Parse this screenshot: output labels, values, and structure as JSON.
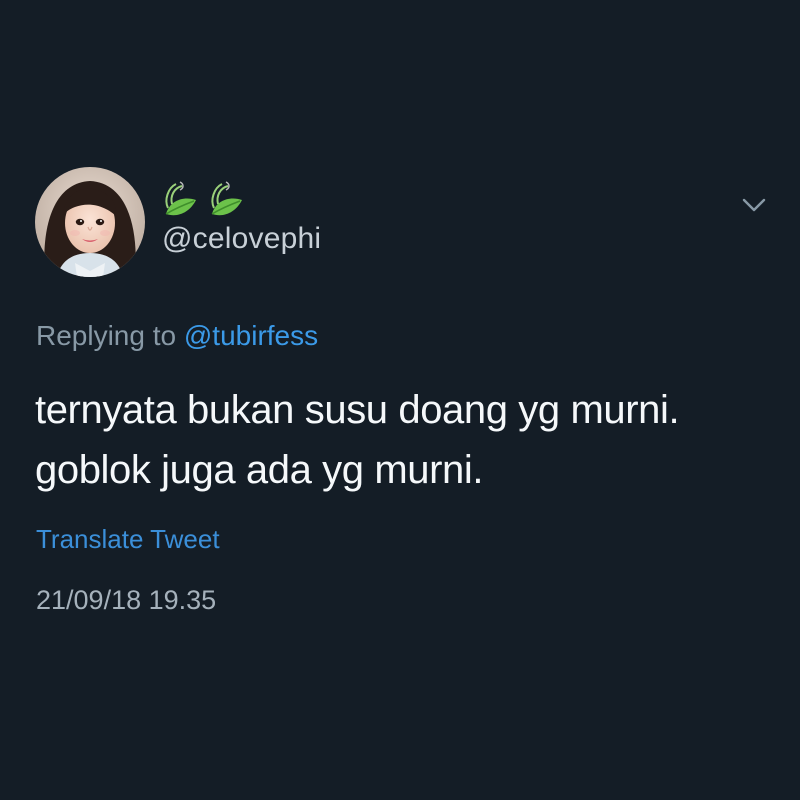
{
  "author": {
    "avatar_icon": "profile-photo-woman",
    "display_name_icons": [
      "herb-leaf-emoji",
      "herb-leaf-emoji"
    ],
    "handle": "@celovephi"
  },
  "menu": {
    "icon": "chevron-down-icon"
  },
  "reply": {
    "prefix": "Replying to",
    "target": "@tubirfess"
  },
  "tweet": {
    "lines": [
      "ternyata bukan susu doang yg murni.",
      "goblok juga ada yg murni."
    ],
    "translate_label": "Translate Tweet",
    "timestamp": "21/09/18 19.35"
  },
  "colors": {
    "background": "#141d26",
    "link": "#3b9ae8",
    "secondary_text": "#8899a6"
  }
}
